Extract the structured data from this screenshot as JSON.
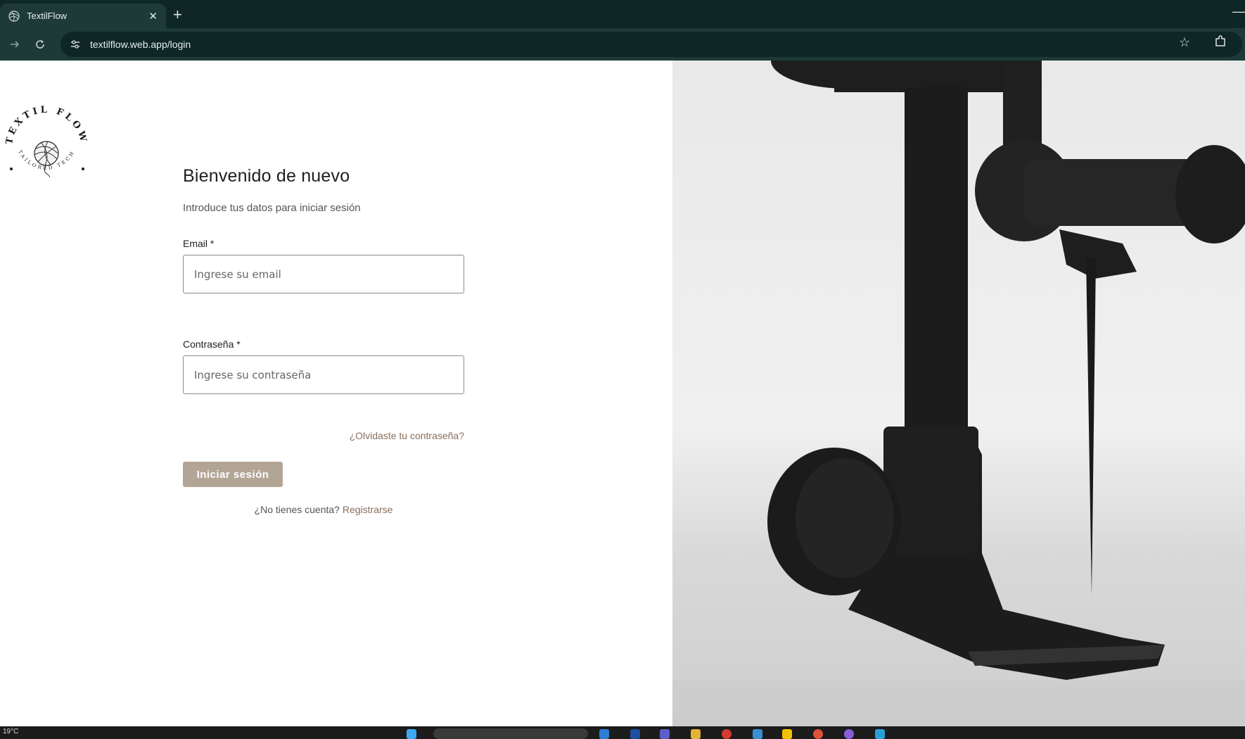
{
  "browser": {
    "tab_title": "TextilFlow",
    "tab_close": "✕",
    "new_tab": "+",
    "url": "textilflow.web.app/login",
    "minimize": "—"
  },
  "logo": {
    "top_text": "TEXTIL FLOW",
    "bottom_text": "TAILORED TECH"
  },
  "login": {
    "title": "Bienvenido de nuevo",
    "subtitle": "Introduce tus datos para iniciar sesión",
    "email_label": "Email",
    "required_mark": "*",
    "email_placeholder": "Ingrese su email",
    "password_label": "Contraseña",
    "password_placeholder": "Ingrese su contraseña",
    "forgot_link": "¿Olvidaste tu contraseña?",
    "submit_label": "Iniciar sesión",
    "no_account_text": "¿No tienes cuenta?",
    "register_link": "Registrarse"
  },
  "taskbar": {
    "weather": "19°C"
  },
  "colors": {
    "accent_button": "#b3a596",
    "link": "#8a6f5c",
    "browser_dark": "#0f2626",
    "browser_mid": "#1d3a38"
  }
}
